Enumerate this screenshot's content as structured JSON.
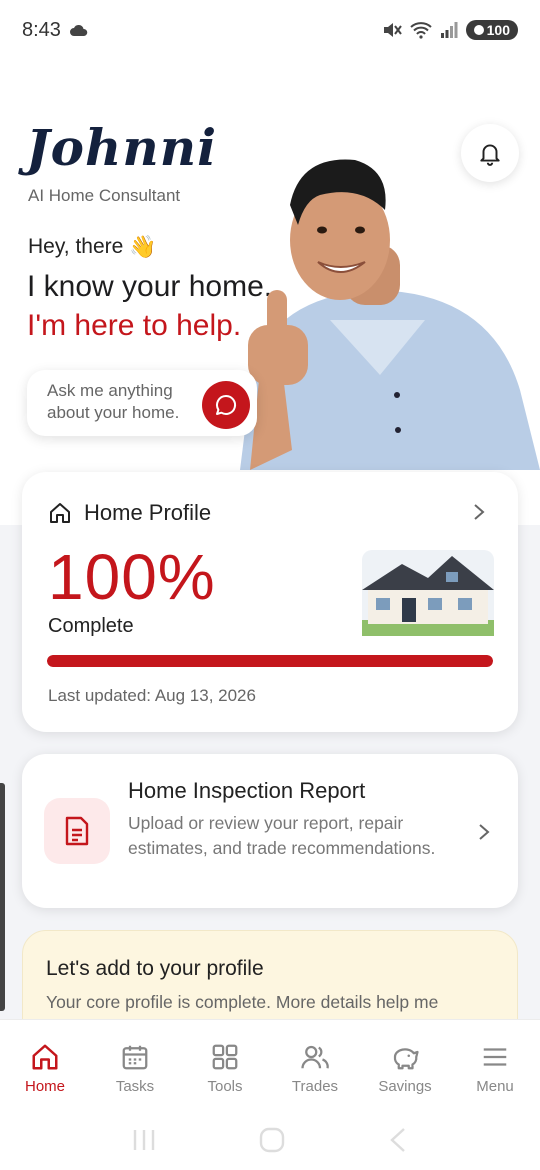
{
  "status_bar": {
    "time": "8:43",
    "battery": "100",
    "icons": [
      "cloud-icon",
      "mute-icon",
      "wifi-icon",
      "signal-icon",
      "battery-icon"
    ]
  },
  "hero": {
    "brand": "Johnni",
    "subtitle": "AI Home Consultant",
    "greeting": "Hey, there",
    "greeting_emoji": "👋",
    "headline_line1": "I know your home.",
    "headline_line2": "I'm here to help.",
    "ask_placeholder": "Ask me anything about your home."
  },
  "profile_card": {
    "title": "Home Profile",
    "percent": "100%",
    "percent_value": 100,
    "status": "Complete",
    "last_updated": "Last updated: Aug 13, 2026"
  },
  "inspection_card": {
    "title": "Home Inspection Report",
    "description": "Upload or review your report, repair estimates, and trade recommendations."
  },
  "add_card": {
    "title": "Let's add to your profile",
    "description": "Your core profile is complete. More details help me"
  },
  "nav": {
    "items": [
      {
        "label": "Home",
        "icon": "home-icon",
        "active": true
      },
      {
        "label": "Tasks",
        "icon": "calendar-icon",
        "active": false
      },
      {
        "label": "Tools",
        "icon": "grid-icon",
        "active": false
      },
      {
        "label": "Trades",
        "icon": "people-icon",
        "active": false
      },
      {
        "label": "Savings",
        "icon": "piggy-bank-icon",
        "active": false
      },
      {
        "label": "Menu",
        "icon": "hamburger-icon",
        "active": false
      }
    ]
  },
  "colors": {
    "accent": "#c4161c",
    "brand_navy": "#14213d",
    "background_band": "#f3f4f7",
    "add_card_bg": "#fdf6e0"
  }
}
